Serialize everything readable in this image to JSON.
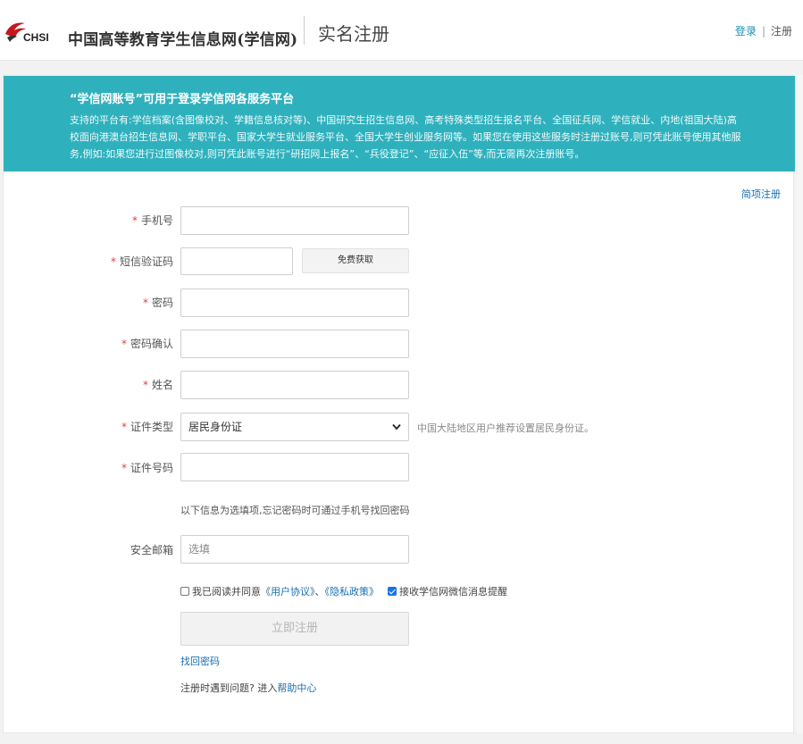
{
  "header": {
    "logo_text": "中国高等教育学生信息网(学信网)",
    "page_title": "实名注册",
    "login_label": "登录",
    "separator": "|",
    "register_label": "注册"
  },
  "banner": {
    "title": "“学信网账号”可用于登录学信网各服务平台",
    "description": "支持的平台有:学信档案(含图像校对、学籍信息核对等)、中国研究生招生信息网、高考特殊类型招生报名平台、全国征兵网、学信就业、内地(祖国大陆)高校面向港澳台招生信息网、学职平台、国家大学生就业服务平台、全国大学生创业服务网等。如果您在使用这些服务时注册过账号,则可凭此账号使用其他服务,例如:如果您进行过图像校对,则可凭此账号进行“研招网上报名”、“兵役登记”、“应征入伍”等,而无需再次注册账号。"
  },
  "simple_register_label": "简项注册",
  "form": {
    "required_mark": "*",
    "phone_label": "手机号",
    "sms_label": "短信验证码",
    "sms_button": "免费获取",
    "password_label": "密码",
    "password_confirm_label": "密码确认",
    "name_label": "姓名",
    "id_type_label": "证件类型",
    "id_type_value": "居民身份证",
    "id_type_hint": "中国大陆地区用户推荐设置居民身份证。",
    "id_number_label": "证件号码",
    "optional_note": "以下信息为选填项,忘记密码时可通过手机号找回密码",
    "email_label": "安全邮箱",
    "email_placeholder": "选填",
    "agree_prefix": "我已阅读并同意",
    "user_agreement": "《用户协议》",
    "agree_separator": "、",
    "privacy_policy": "《隐私政策》",
    "wechat_notice": "接收学信网微信消息提醒",
    "submit_label": "立即注册",
    "find_password": "找回密码",
    "help_prefix": "注册时遇到问题? 进入",
    "help_link": "帮助中心"
  },
  "colors": {
    "banner_bg": "#2fb1bd",
    "link": "#1a6fb0",
    "required": "#e04040",
    "logo_red": "#c8161d"
  }
}
